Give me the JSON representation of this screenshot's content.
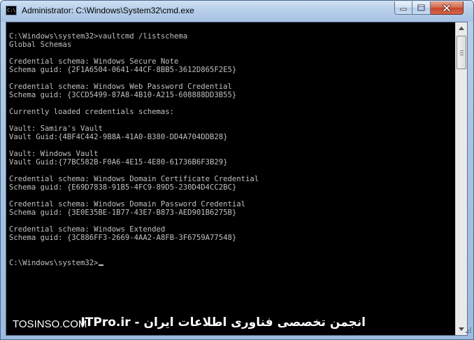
{
  "window": {
    "title": "Administrator: C:\\Windows\\System32\\cmd.exe",
    "app_icon": "cmd-icon",
    "icon_text": "C:\\",
    "buttons": [
      "minimize-icon",
      "maximize-icon",
      "close-icon"
    ]
  },
  "console": {
    "lines": [
      "C:\\Windows\\system32>vaultcmd /listschema",
      "Global Schemas",
      "",
      "Credential schema: Windows Secure Note",
      "Schema guid: {2F1A6504-0641-44CF-8BB5-3612D865F2E5}",
      "",
      "Credential schema: Windows Web Password Credential",
      "Schema guid: {3CCD5499-87A8-4B10-A215-608888DD3B55}",
      "",
      "Currently loaded credentials schemas:",
      "",
      "Vault: Samira's Vault",
      "Vault Guid:{4BF4C442-9B8A-41A0-B380-DD4A704DDB28}",
      "",
      "Vault: Windows Vault",
      "Vault Guid:{77BC582B-F0A6-4E15-4E80-61736B6F3B29}",
      "",
      "Credential schema: Windows Domain Certificate Credential",
      "Schema guid: {E69D7838-91B5-4FC9-89D5-230D4D4CC2BC}",
      "",
      "Credential schema: Windows Domain Password Credential",
      "Schema guid: {3E0E35BE-1B77-43E7-B873-AED901B6275B}",
      "",
      "Credential schema: Windows Extended",
      "Schema guid: {3C886FF3-2669-4AA2-A8FB-3F6759A77548}",
      "",
      "",
      "C:\\Windows\\system32>"
    ],
    "text_color": "#c0c0c0",
    "background": "#000000"
  },
  "watermark": {
    "left": "TOSINSO.COM",
    "right": "ITPro.ir - انجمن تخصصی فناوری اطلاعات ایران"
  }
}
